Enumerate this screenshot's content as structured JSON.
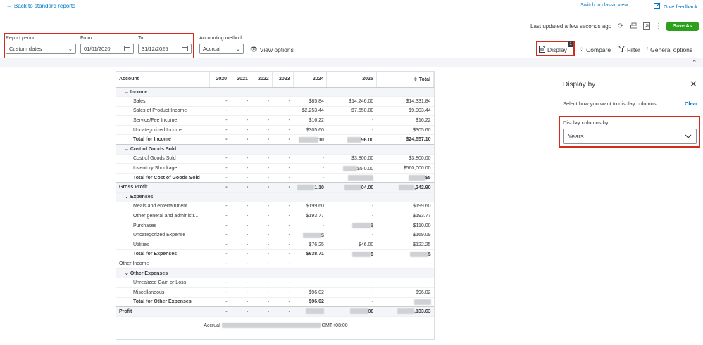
{
  "topbar": {
    "back": "Back to standard reports",
    "classic": "Switch to classic view",
    "feedback": "Give feedback"
  },
  "header": {
    "last_updated": "Last updated a few seconds ago",
    "save_as": "Save As"
  },
  "filters": {
    "report_period_label": "Report period",
    "report_period_value": "Custom dates",
    "from_label": "From",
    "from_value": "01/01/2020",
    "to_label": "To",
    "to_value": "31/12/2025",
    "method_label": "Accounting method",
    "method_value": "Accrual",
    "view_options": "View options"
  },
  "toolbar": {
    "display": "Display",
    "display_badge": "1",
    "compare": "Compare",
    "filter": "Filter",
    "general": "General options"
  },
  "table": {
    "headers": [
      "Account",
      "2020",
      "2021",
      "2022",
      "2023",
      "2024",
      "2025",
      "Total"
    ],
    "rows": [
      {
        "type": "section",
        "label": "Income",
        "cells": [
          "",
          "",
          "",
          "",
          "",
          "",
          ""
        ]
      },
      {
        "type": "line",
        "indent": 2,
        "label": "Sales",
        "cells": [
          "-",
          "-",
          "-",
          "-",
          "$85.84",
          "$14,246.00",
          "$14,331.84"
        ]
      },
      {
        "type": "line",
        "indent": 2,
        "label": "Sales of Product Income",
        "cells": [
          "-",
          "-",
          "-",
          "-",
          "$2,253.44",
          "$7,650.00",
          "$9,903.44"
        ]
      },
      {
        "type": "line",
        "indent": 2,
        "label": "Service/Fee Income",
        "cells": [
          "-",
          "-",
          "-",
          "-",
          "$16.22",
          "-",
          "$16.22"
        ]
      },
      {
        "type": "line",
        "indent": 2,
        "label": "Uncategorized Income",
        "cells": [
          "-",
          "-",
          "-",
          "-",
          "$305.60",
          "-",
          "$305.60"
        ]
      },
      {
        "type": "total",
        "indent": 2,
        "label": "Total for Income",
        "cells": [
          "-",
          "-",
          "-",
          "-",
          "10",
          "96.00",
          "$24,557.10"
        ]
      },
      {
        "type": "section",
        "label": "Cost of Goods Sold",
        "cells": [
          "",
          "",
          "",
          "",
          "",
          "",
          ""
        ]
      },
      {
        "type": "line",
        "indent": 2,
        "label": "Cost of Goods Sold",
        "cells": [
          "-",
          "-",
          "-",
          "-",
          "-",
          "$3,800.00",
          "$3,800.00"
        ]
      },
      {
        "type": "line",
        "indent": 2,
        "label": "Inventory Shrinkage",
        "cells": [
          "-",
          "-",
          "-",
          "-",
          "-",
          "$5 0.00",
          "$560,000.00"
        ]
      },
      {
        "type": "total",
        "indent": 2,
        "label": "Total for Cost of Goods Sold",
        "cells": [
          "-",
          "-",
          "-",
          "-",
          "-",
          "",
          "$5"
        ]
      },
      {
        "type": "grand",
        "indent": 0,
        "label": "Gross Profit",
        "cells": [
          "-",
          "-",
          "-",
          "-",
          "1.10",
          "04.00",
          ",242.90"
        ]
      },
      {
        "type": "section",
        "label": "Expenses",
        "cells": [
          "",
          "",
          "",
          "",
          "",
          "",
          ""
        ]
      },
      {
        "type": "line",
        "indent": 2,
        "label": "Meals and entertainment",
        "cells": [
          "-",
          "-",
          "-",
          "-",
          "$199.60",
          "-",
          "$199.60"
        ]
      },
      {
        "type": "line",
        "indent": 2,
        "label": "Other general and administr...",
        "cells": [
          "-",
          "-",
          "-",
          "-",
          "$193.77",
          "-",
          "$193.77"
        ]
      },
      {
        "type": "line",
        "indent": 2,
        "label": "Purchases",
        "cells": [
          "-",
          "-",
          "-",
          "-",
          "-",
          "$",
          "$110.00"
        ]
      },
      {
        "type": "line",
        "indent": 2,
        "label": "Uncategorized Expense",
        "cells": [
          "-",
          "-",
          "-",
          "-",
          "$",
          "-",
          "$169.09"
        ]
      },
      {
        "type": "line",
        "indent": 2,
        "label": "Utilities",
        "cells": [
          "-",
          "-",
          "-",
          "-",
          "$76.25",
          "$46.00",
          "$122.25"
        ]
      },
      {
        "type": "total",
        "indent": 2,
        "label": "Total for Expenses",
        "cells": [
          "-",
          "-",
          "-",
          "-",
          "$638.71",
          "$",
          "$"
        ]
      },
      {
        "type": "line",
        "indent": 0,
        "label": "Other Income",
        "cells": [
          "-",
          "-",
          "-",
          "-",
          "-",
          "-",
          "-"
        ]
      },
      {
        "type": "section",
        "label": "Other Expenses",
        "cells": [
          "",
          "",
          "",
          "",
          "",
          "",
          ""
        ]
      },
      {
        "type": "line",
        "indent": 2,
        "label": "Unrealized Gain or Loss",
        "cells": [
          "-",
          "-",
          "-",
          "-",
          "-",
          "-",
          "-"
        ]
      },
      {
        "type": "line",
        "indent": 2,
        "label": "Miscellaneous",
        "cells": [
          "-",
          "-",
          "-",
          "-",
          "$96.02",
          "-",
          "$96.02"
        ]
      },
      {
        "type": "total",
        "indent": 2,
        "label": "Total for Other Expenses",
        "cells": [
          "-",
          "-",
          "-",
          "-",
          "$96.02",
          "-",
          ""
        ]
      },
      {
        "type": "grand",
        "indent": 0,
        "label": "Profit",
        "cells": [
          "-",
          "-",
          "-",
          "-",
          "",
          "00",
          ",133.63"
        ]
      }
    ],
    "footer_left": "Accrual",
    "footer_right": "GMT+08:00"
  },
  "panel": {
    "title": "Display by",
    "subtitle": "Select how you want to display columns.",
    "clear": "Clear",
    "columns_label": "Display columns by",
    "columns_value": "Years"
  },
  "colors": {
    "accent": "#0077c5",
    "save": "#2ca01c",
    "highlight": "#d52b1e"
  }
}
